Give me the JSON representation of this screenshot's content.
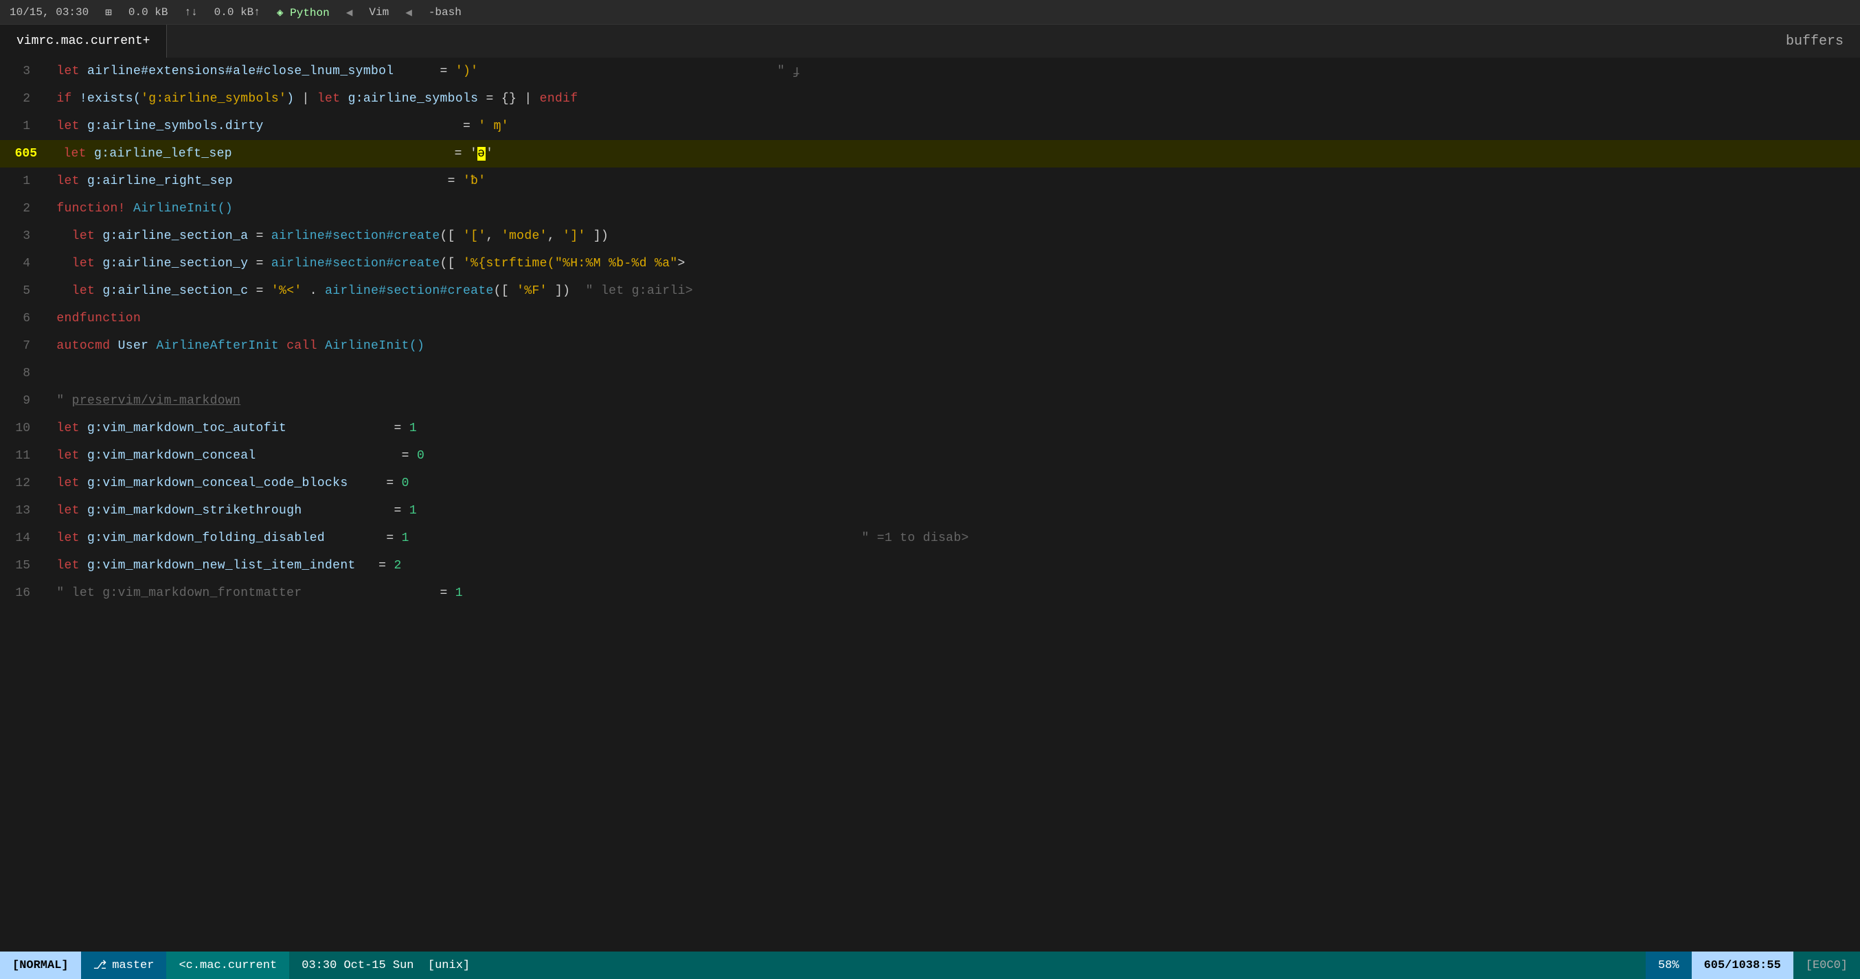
{
  "topbar": {
    "time": "10/15, 03:30",
    "buf1": "0.0 kB",
    "buf2": "0.0 kB↑",
    "lang": "Python",
    "editor": "Vim",
    "shell": "-bash"
  },
  "tab": {
    "filename": "vimrc.mac.current+",
    "buffers_label": "buffers"
  },
  "statusbar": {
    "mode": "[NORMAL]",
    "branch_icon": "⎇",
    "branch": "master",
    "file": "<c.mac.current",
    "time": "03:30 Oct-15 Sun",
    "os": "[unix]",
    "pct": "58%",
    "pos": "605/1038:55",
    "enc": "[E0C0]"
  },
  "lines": [
    {
      "num": "3",
      "rel": "-3",
      "content": "  let airline#extensions#ale#close_lnum_symbol      = ')'"
    },
    {
      "num": "2",
      "content": "  if !exists('g:airline_symbols') | let g:airline_symbols = {} | endif"
    },
    {
      "num": "1",
      "content": "  let g:airline_symbols.dirty                        = ' ɱ'"
    },
    {
      "num": "605",
      "current": true,
      "content": "  let g:airline_left_sep                            = 'ǝ'"
    },
    {
      "num": "1",
      "content": "  let g:airline_right_sep                           = 'ƀ'"
    },
    {
      "num": "2",
      "content": "  function! AirlineInit()"
    },
    {
      "num": "3",
      "content": "    let g:airline_section_a = airline#section#create([ '[', 'mode', ']' ])"
    },
    {
      "num": "4",
      "content": "    let g:airline_section_y = airline#section#create([ '%{strftime(\"%H:%M %b-%d %a\">"
    },
    {
      "num": "5",
      "content": "    let g:airline_section_c = '%<' . airline#section#create([ '%F' ])  \" let g:airli>"
    },
    {
      "num": "6",
      "content": "  endfunction"
    },
    {
      "num": "7",
      "content": "  autocmd User AirlineAfterInit call AirlineInit()"
    },
    {
      "num": "8",
      "content": ""
    },
    {
      "num": "9",
      "content": "  \" preservim/vim-markdown"
    },
    {
      "num": "10",
      "content": "  let g:vim_markdown_toc_autofit              = 1"
    },
    {
      "num": "11",
      "content": "  let g:vim_markdown_conceal                 = 0"
    },
    {
      "num": "12",
      "content": "  let g:vim_markdown_conceal_code_blocks     = 0"
    },
    {
      "num": "13",
      "content": "  let g:vim_markdown_strikethrough           = 1"
    },
    {
      "num": "14",
      "content": "  let g:vim_markdown_folding_disabled        = 1"
    },
    {
      "num": "15",
      "content": "  let g:vim_markdown_new_list_item_indent    = 2"
    },
    {
      "num": "16",
      "content": "  \" let g:vim_markdown_frontmatter            = 1"
    }
  ],
  "right_comment_14": "\" =1 to disab>",
  "right_comment_top": "\" ɟ"
}
